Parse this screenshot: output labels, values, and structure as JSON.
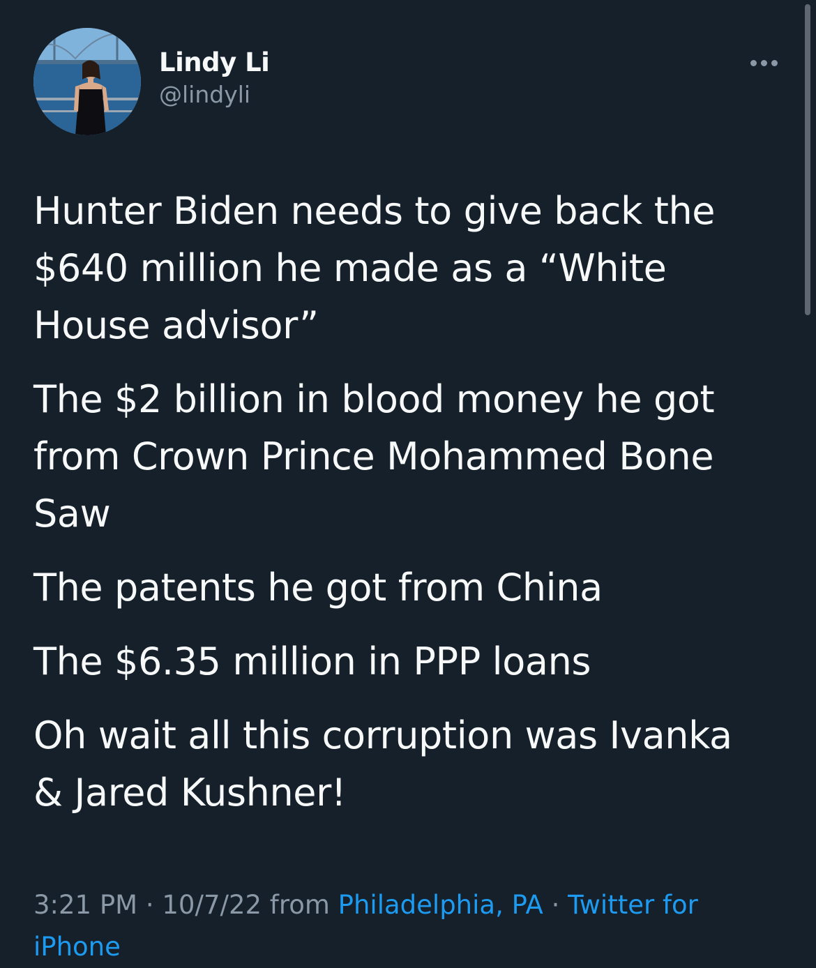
{
  "author": {
    "display_name": "Lindy Li",
    "handle": "@lindyli",
    "avatar_icon": "profile-photo"
  },
  "more_icon": "ellipsis-icon",
  "tweet": {
    "paragraphs": [
      "Hunter Biden needs to give back the\n$640 million he made as a “White\nHouse advisor”",
      "The $2 billion in blood money he got\nfrom Crown Prince Mohammed Bone\nSaw",
      "The patents he got from China",
      "The $6.35 million in PPP loans",
      "Oh wait all this corruption was Ivanka\n& Jared Kushner!"
    ]
  },
  "meta": {
    "time": "3:21 PM",
    "sep1": " · ",
    "date": "10/7/22",
    "from_word": " from ",
    "location": "Philadelphia, PA",
    "sep2": " · ",
    "client": "Twitter for iPhone"
  },
  "colors": {
    "background": "#15202b",
    "text": "#f7f9f9",
    "muted": "#8b98a5",
    "link": "#1d9bf0"
  }
}
